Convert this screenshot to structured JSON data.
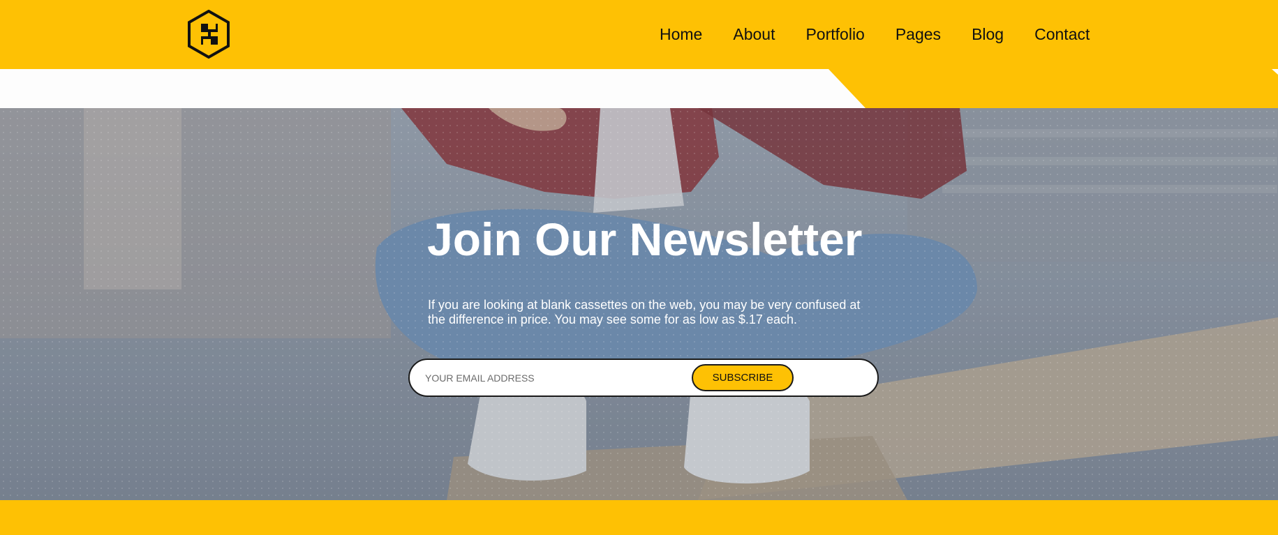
{
  "brand": {
    "logo_icon": "hexagon-s-logo-icon",
    "accent_color": "#FEC104",
    "dark_color": "#111111"
  },
  "nav": {
    "items": [
      {
        "label": "Home"
      },
      {
        "label": "About"
      },
      {
        "label": "Portfolio"
      },
      {
        "label": "Pages"
      },
      {
        "label": "Blog"
      },
      {
        "label": "Contact"
      }
    ]
  },
  "hero": {
    "background": "photo-person-sitting-with-phone",
    "title": "Join Our Newsletter",
    "description": "If you are looking at blank cassettes on the web, you may be very confused at the difference in price. You may see some for as low as $.17 each.",
    "form": {
      "email_placeholder": "YOUR EMAIL ADDRESS",
      "email_value": "",
      "subscribe_label": "SUBSCRIBE"
    }
  }
}
